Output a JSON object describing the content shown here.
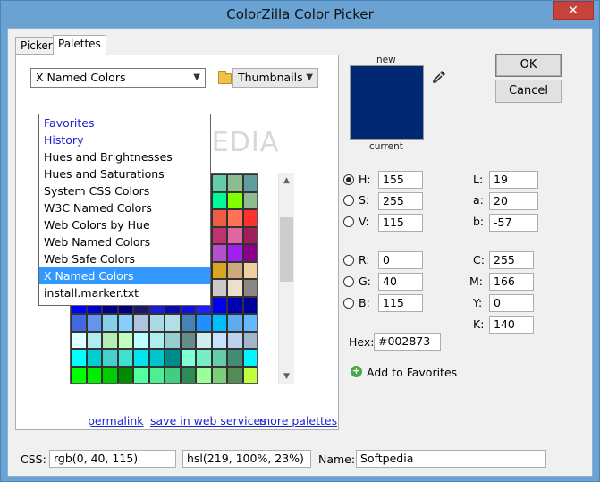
{
  "window": {
    "title": "ColorZilla Color Picker",
    "close_glyph": "✕"
  },
  "tabs": [
    {
      "label": "Picker"
    },
    {
      "label": "Palettes"
    }
  ],
  "palette_select": {
    "value": "X Named Colors"
  },
  "view_select": {
    "value": "Thumbnails"
  },
  "dropdown": {
    "items": [
      {
        "label": "Favorites"
      },
      {
        "label": "History"
      },
      {
        "label": "Hues and Brightnesses"
      },
      {
        "label": "Hues and Saturations"
      },
      {
        "label": "System CSS Colors"
      },
      {
        "label": "W3C Named Colors"
      },
      {
        "label": "Web Colors by Hue"
      },
      {
        "label": "Web Named Colors"
      },
      {
        "label": "Web Safe Colors"
      },
      {
        "label": "X Named Colors"
      },
      {
        "label": "install.marker.txt"
      }
    ]
  },
  "watermark": "SOFTPEDIA",
  "links": {
    "permalink": "permalink",
    "save": "save in web services",
    "more": "more palettes"
  },
  "preview": {
    "new_label": "new",
    "current_label": "current",
    "color": "#002873"
  },
  "buttons": {
    "ok": "OK",
    "cancel": "Cancel"
  },
  "hsv": {
    "h_label": "H:",
    "h": "155",
    "s_label": "S:",
    "s": "255",
    "v_label": "V:",
    "v": "115"
  },
  "lab": {
    "l_label": "L:",
    "l": "19",
    "a_label": "a:",
    "a": "20",
    "b_label": "b:",
    "b": "-57"
  },
  "rgb": {
    "r_label": "R:",
    "r": "0",
    "g_label": "G:",
    "g": "40",
    "b_label": "B:",
    "b": "115"
  },
  "cmyk": {
    "c_label": "C:",
    "c": "255",
    "m_label": "M:",
    "m": "166",
    "y_label": "Y:",
    "y": "0",
    "k_label": "K:",
    "k": "140"
  },
  "hex": {
    "label": "Hex:",
    "value": "#002873"
  },
  "favorites": {
    "label": "Add to Favorites"
  },
  "bottom": {
    "css_label": "CSS:",
    "css_rgb": "rgb(0, 40, 115)",
    "css_hsl": "hsl(219, 100%, 23%)",
    "name_label": "Name:",
    "name_value": "Softpedia"
  }
}
